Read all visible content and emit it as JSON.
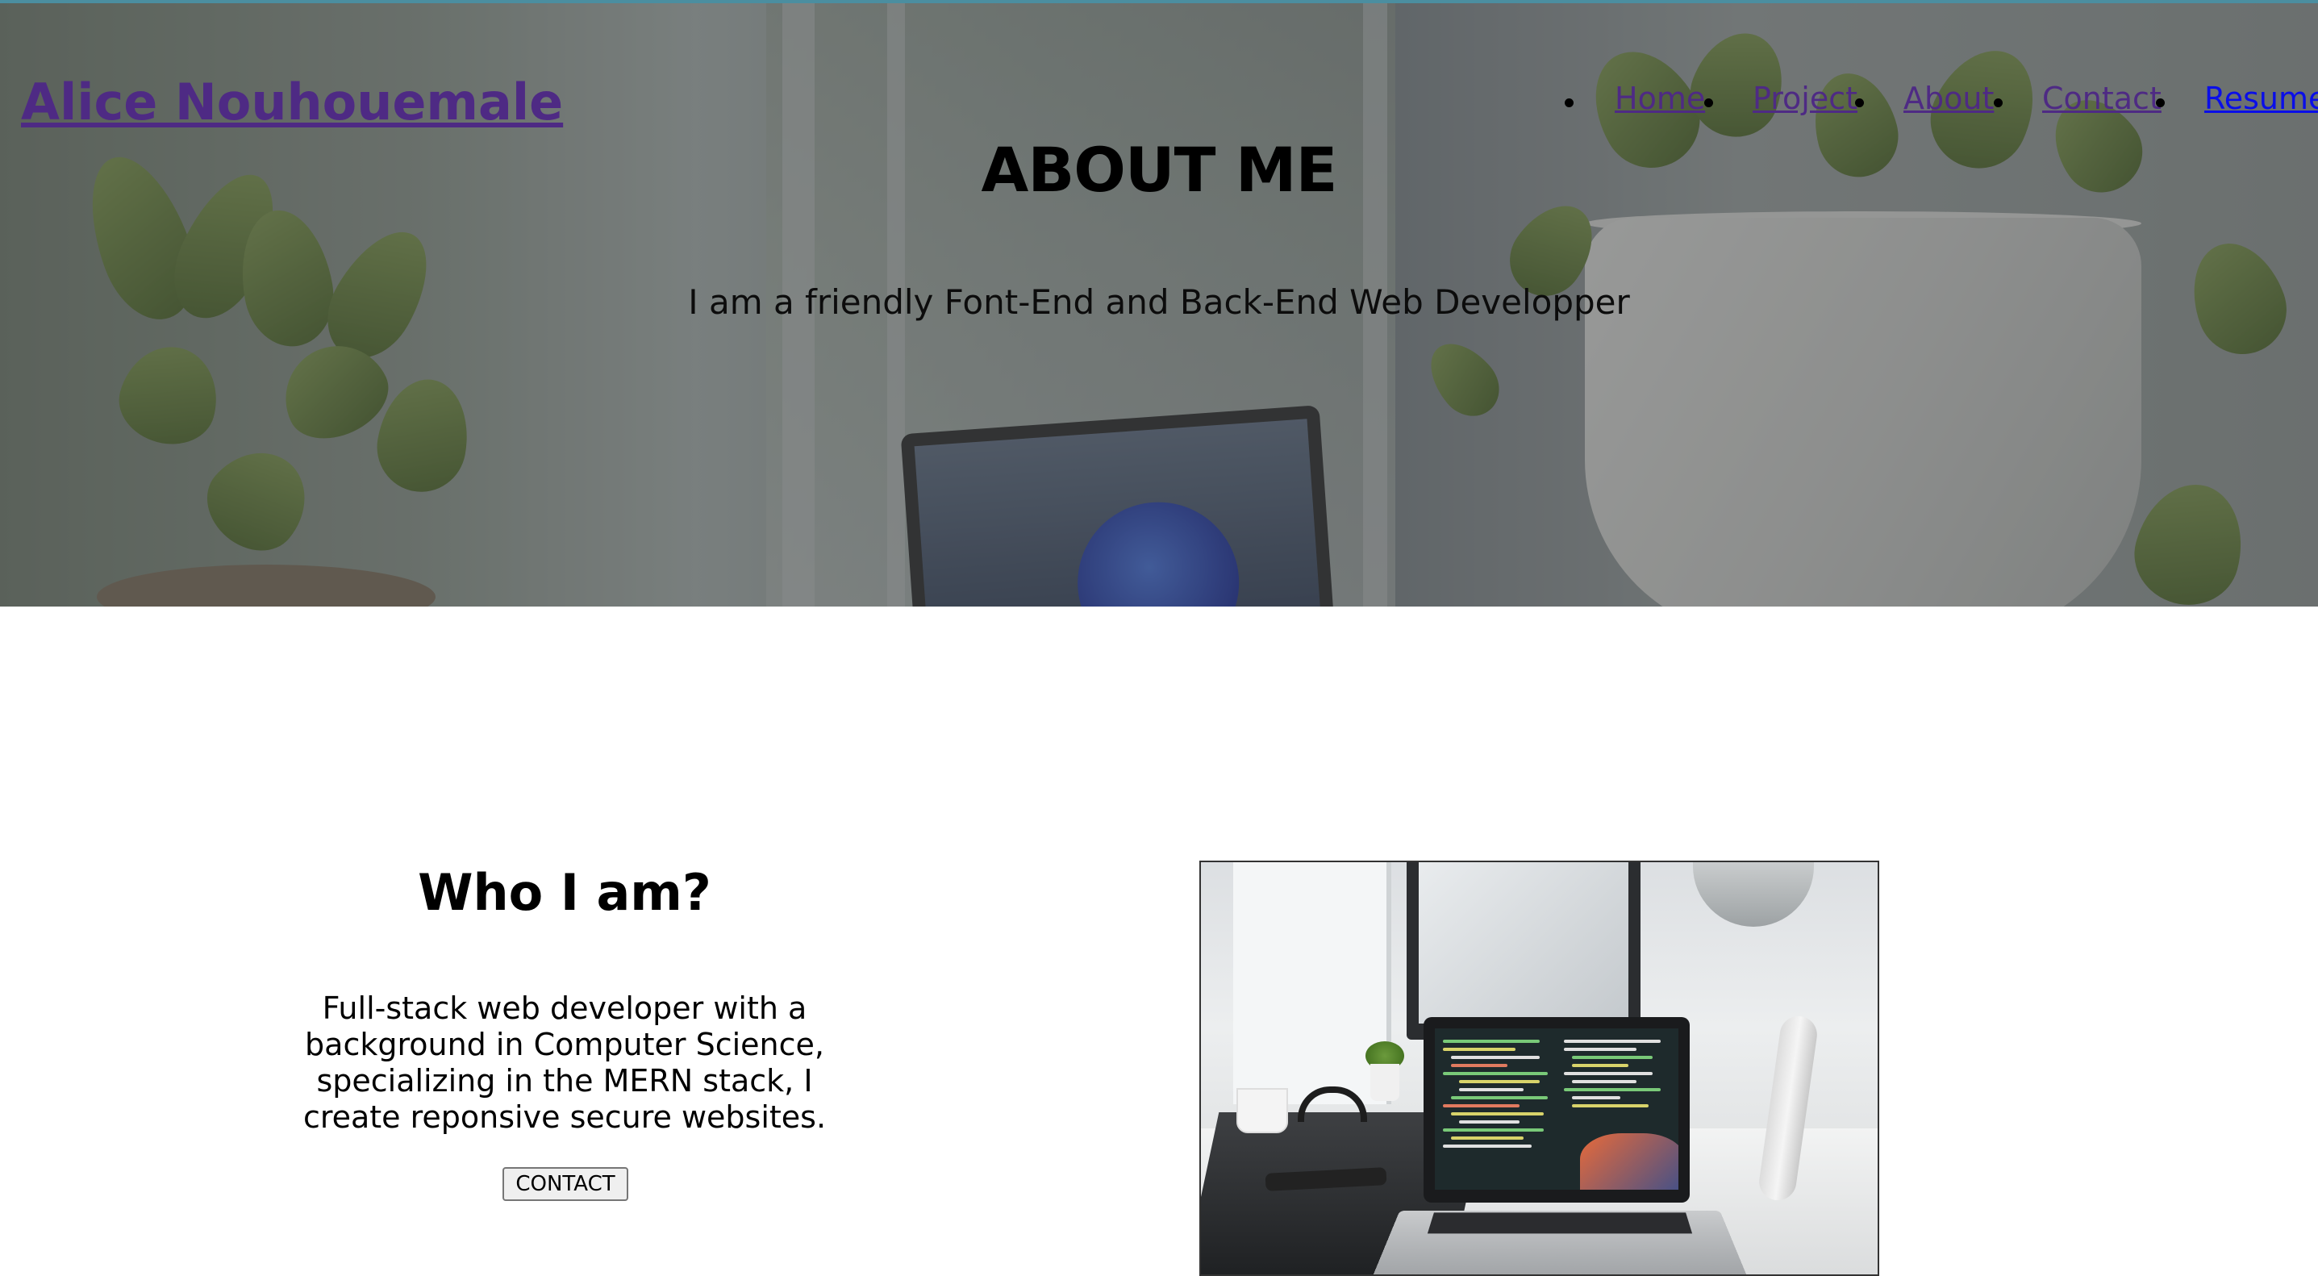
{
  "header": {
    "brand": "Alice Nouhouemale",
    "nav": [
      {
        "label": "Home"
      },
      {
        "label": "Project"
      },
      {
        "label": "About"
      },
      {
        "label": "Contact"
      },
      {
        "label": "Resume"
      }
    ]
  },
  "hero": {
    "title": "ABOUT ME",
    "subtitle": "I am a friendly Font-End and Back-End Web Developper"
  },
  "about": {
    "title": "Who I am?",
    "text": "Full-stack web developer with a background in Computer Science, specializing in the MERN stack, I create reponsive secure websites.",
    "button_label": "CONTACT"
  },
  "colors": {
    "visited_link": "#4e2a84",
    "link": "#0a0ee8",
    "top_border": "#4b8ea0"
  }
}
